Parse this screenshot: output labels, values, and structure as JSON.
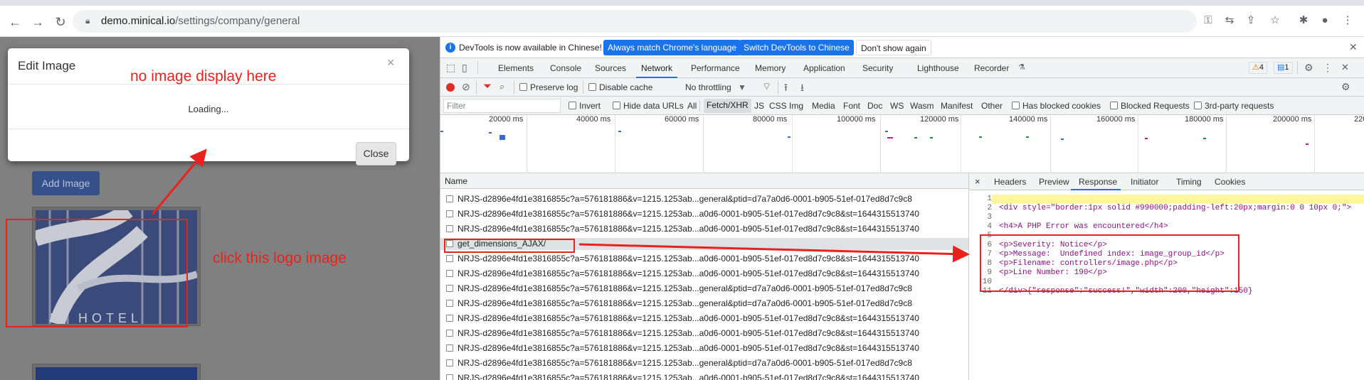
{
  "browser": {
    "url_host": "demo.minical.io",
    "url_path": "/settings/company/general"
  },
  "page": {
    "modal_title": "Edit Image",
    "modal_close": "×",
    "loading_text": "Loading...",
    "close_button": "Close",
    "add_image_button": "Add Image",
    "annotations": {
      "no_image": "no image display here",
      "click_logo": "click this logo image"
    }
  },
  "devtools": {
    "infobar_text": "DevTools is now available in Chinese!",
    "btn_match": "Always match Chrome's language",
    "btn_switch": "Switch DevTools to Chinese",
    "btn_dont_show": "Don't show again",
    "tabs": [
      "Elements",
      "Console",
      "Sources",
      "Network",
      "Performance",
      "Memory",
      "Application",
      "Security",
      "Lighthouse",
      "Recorder"
    ],
    "warnings_count": "4",
    "issues_count": "1",
    "toolbar": {
      "preserve_log": "Preserve log",
      "disable_cache": "Disable cache",
      "throttling": "No throttling"
    },
    "filter": {
      "placeholder": "Filter",
      "invert": "Invert",
      "hide_data_urls": "Hide data URLs",
      "types": [
        "All",
        "Fetch/XHR",
        "JS",
        "CSS",
        "Img",
        "Media",
        "Font",
        "Doc",
        "WS",
        "Wasm",
        "Manifest",
        "Other"
      ],
      "has_blocked_cookies": "Has blocked cookies",
      "blocked_requests": "Blocked Requests",
      "third_party": "3rd-party requests"
    },
    "overview_ticks": [
      "20000 ms",
      "40000 ms",
      "60000 ms",
      "80000 ms",
      "100000 ms",
      "120000 ms",
      "140000 ms",
      "160000 ms",
      "180000 ms",
      "200000 ms",
      "220"
    ],
    "name_header": "Name",
    "requests": [
      "NRJS-d2896e4fd1e3816855c?a=576181886&v=1215.1253ab...general&ptid=d7a7a0d6-0001-b905-51ef-017ed8d7c9c8",
      "NRJS-d2896e4fd1e3816855c?a=576181886&v=1215.1253ab...a0d6-0001-b905-51ef-017ed8d7c9c8&st=1644315513740",
      "NRJS-d2896e4fd1e3816855c?a=576181886&v=1215.1253ab...a0d6-0001-b905-51ef-017ed8d7c9c8&st=1644315513740",
      "get_dimensions_AJAX/",
      "NRJS-d2896e4fd1e3816855c?a=576181886&v=1215.1253ab...a0d6-0001-b905-51ef-017ed8d7c9c8&st=1644315513740",
      "NRJS-d2896e4fd1e3816855c?a=576181886&v=1215.1253ab...a0d6-0001-b905-51ef-017ed8d7c9c8&st=1644315513740",
      "NRJS-d2896e4fd1e3816855c?a=576181886&v=1215.1253ab...general&ptid=d7a7a0d6-0001-b905-51ef-017ed8d7c9c8",
      "NRJS-d2896e4fd1e3816855c?a=576181886&v=1215.1253ab...general&ptid=d7a7a0d6-0001-b905-51ef-017ed8d7c9c8",
      "NRJS-d2896e4fd1e3816855c?a=576181886&v=1215.1253ab...a0d6-0001-b905-51ef-017ed8d7c9c8&st=1644315513740",
      "NRJS-d2896e4fd1e3816855c?a=576181886&v=1215.1253ab...a0d6-0001-b905-51ef-017ed8d7c9c8&st=1644315513740",
      "NRJS-d2896e4fd1e3816855c?a=576181886&v=1215.1253ab...a0d6-0001-b905-51ef-017ed8d7c9c8&st=1644315513740",
      "NRJS-d2896e4fd1e3816855c?a=576181886&v=1215.1253ab...general&ptid=d7a7a0d6-0001-b905-51ef-017ed8d7c9c8",
      "NRJS-d2896e4fd1e3816855c?a=576181886&v=1215.1253ab...a0d6-0001-b905-51ef-017ed8d7c9c8&st=1644315513740"
    ],
    "response_tabs": [
      "Headers",
      "Preview",
      "Response",
      "Initiator",
      "Timing",
      "Cookies"
    ],
    "response_close": "×",
    "response_lines": [
      {
        "n": "1",
        "text": ""
      },
      {
        "n": "2",
        "text": "<div style=\"border:1px solid #990000;padding-left:20px;margin:0 0 10px 0;\">"
      },
      {
        "n": "3",
        "text": ""
      },
      {
        "n": "4",
        "text": "<h4>A PHP Error was encountered</h4>"
      },
      {
        "n": "5",
        "text": ""
      },
      {
        "n": "6",
        "text": "<p>Severity: Notice</p>"
      },
      {
        "n": "7",
        "text": "<p>Message:  Undefined index: image_group_id</p>"
      },
      {
        "n": "8",
        "text": "<p>Filename: controllers/image.php</p>"
      },
      {
        "n": "9",
        "text": "<p>Line Number: 190</p>"
      },
      {
        "n": "10",
        "text": ""
      },
      {
        "n": "11",
        "text": "</div>{\"response\":\"success!\",\"width\":200,\"height\":150}"
      }
    ]
  }
}
